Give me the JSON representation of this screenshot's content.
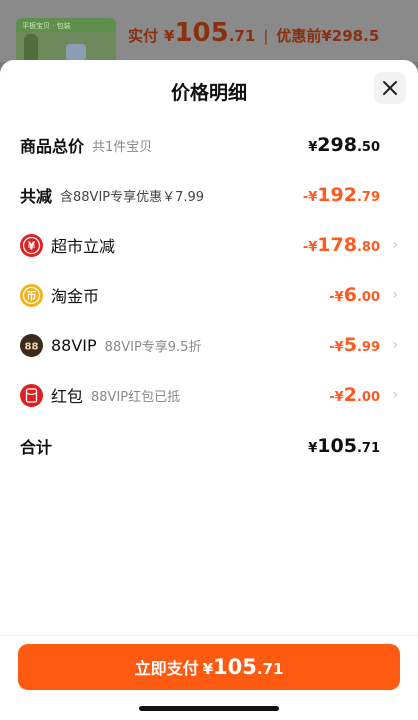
{
  "background_header": {
    "thumb_text": "平板宝贝 · 包装",
    "paid_label": "实付",
    "paid_currency": "¥",
    "paid_int": "105",
    "paid_dec": ".71",
    "separator": "|",
    "original_text": "优惠前¥298.5"
  },
  "sheet": {
    "title": "价格明细",
    "rows": [
      {
        "title": "商品总价",
        "sub": "共1件宝贝",
        "currency": "¥",
        "int": "298",
        "dec": ".50"
      },
      {
        "title": "共减",
        "sub": "含88VIP专享优惠￥7.99",
        "currency": "-¥",
        "int": "192",
        "dec": ".79"
      },
      {
        "title": "超市立减",
        "icon": "yuan-discount-icon",
        "currency": "-¥",
        "int": "178",
        "dec": ".80"
      },
      {
        "title": "淘金币",
        "icon": "coin-icon",
        "currency": "-¥",
        "int": "6",
        "dec": ".00"
      },
      {
        "title": "88VIP",
        "sub": "88VIP专享9.5折",
        "icon": "88vip-icon",
        "currency": "-¥",
        "int": "5",
        "dec": ".99"
      },
      {
        "title": "红包",
        "sub": "88VIP红包已抵",
        "icon": "red-packet-icon",
        "currency": "-¥",
        "int": "2",
        "dec": ".00"
      },
      {
        "title": "合计",
        "currency": "¥",
        "int": "105",
        "dec": ".71"
      }
    ],
    "pay_button": {
      "label": "立即支付",
      "currency": "¥",
      "int": "105",
      "dec": ".71"
    }
  },
  "colors": {
    "accent": "#ff5a12",
    "discount": "#ff5a1f",
    "icon_red": "#e02020",
    "icon_gold": "#f4b21a",
    "icon_dark": "#3b2a20"
  }
}
